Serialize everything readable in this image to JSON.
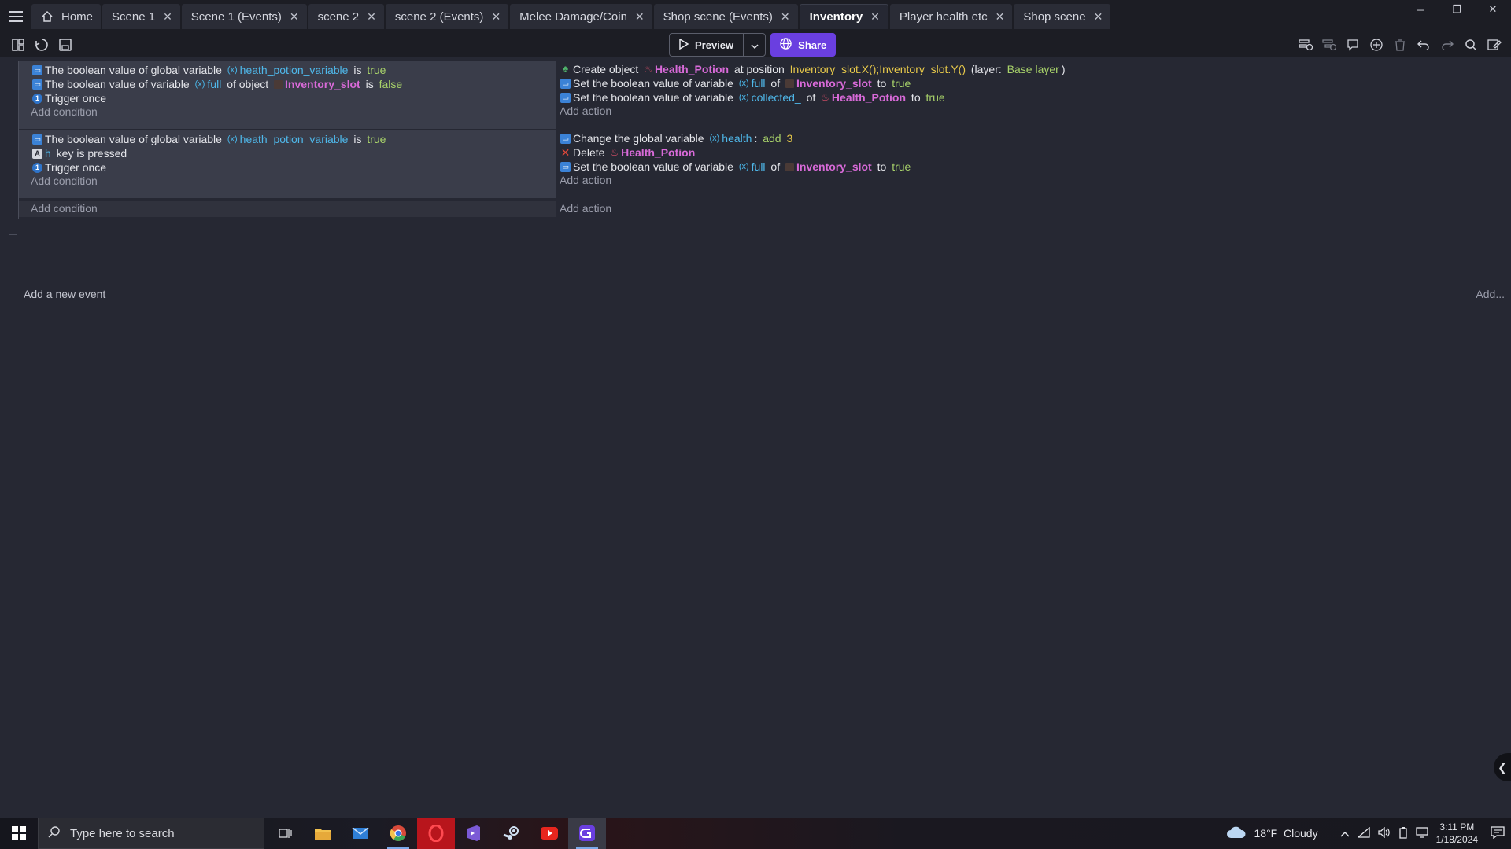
{
  "window": {
    "tabs": [
      {
        "label": "Home",
        "closable": false
      },
      {
        "label": "Scene 1",
        "closable": true
      },
      {
        "label": "Scene 1 (Events)",
        "closable": true
      },
      {
        "label": "scene 2",
        "closable": true
      },
      {
        "label": "scene 2 (Events)",
        "closable": true
      },
      {
        "label": "Melee Damage/Coin",
        "closable": true
      },
      {
        "label": "Shop scene (Events)",
        "closable": true
      },
      {
        "label": "Inventory",
        "closable": true,
        "active": true
      },
      {
        "label": "Player health etc",
        "closable": true
      },
      {
        "label": "Shop scene",
        "closable": true
      }
    ],
    "close_glyph": "✕"
  },
  "toolbar": {
    "preview_label": "Preview",
    "share_label": "Share"
  },
  "events": [
    {
      "conditions": [
        {
          "icon": "boolean-icon",
          "parts": [
            {
              "t": "The boolean value of global variable ",
              "c": "plain"
            },
            {
              "t": "(x)",
              "c": "var-icon"
            },
            {
              "t": "heath_potion_variable",
              "c": "var"
            },
            {
              "t": " is ",
              "c": "plain"
            },
            {
              "t": "true",
              "c": "bool"
            }
          ]
        },
        {
          "icon": "boolean-icon",
          "parts": [
            {
              "t": "The boolean value of variable ",
              "c": "plain"
            },
            {
              "t": "(x)",
              "c": "var-icon"
            },
            {
              "t": "full",
              "c": "var"
            },
            {
              "t": " of object ",
              "c": "plain"
            },
            {
              "t": "",
              "c": "slot-icon"
            },
            {
              "t": "Inventory_slot",
              "c": "obj"
            },
            {
              "t": " is ",
              "c": "plain"
            },
            {
              "t": "false",
              "c": "bool"
            }
          ]
        },
        {
          "icon": "trigger-icon",
          "parts": [
            {
              "t": "Trigger once",
              "c": "plain"
            }
          ]
        }
      ],
      "add_condition": "Add condition",
      "actions": [
        {
          "icon": "create-icon",
          "parts": [
            {
              "t": "Create object ",
              "c": "plain"
            },
            {
              "t": "",
              "c": "potion-icon"
            },
            {
              "t": "Health_Potion",
              "c": "obj"
            },
            {
              "t": " at position ",
              "c": "plain"
            },
            {
              "t": "Inventory_slot.X();Inventory_slot.Y()",
              "c": "expr"
            },
            {
              "t": " (layer: ",
              "c": "plain"
            },
            {
              "t": "Base layer",
              "c": "layer"
            },
            {
              "t": ")",
              "c": "plain"
            }
          ]
        },
        {
          "icon": "boolean-icon",
          "parts": [
            {
              "t": "Set the boolean value of variable ",
              "c": "plain"
            },
            {
              "t": "(x)",
              "c": "var-icon"
            },
            {
              "t": "full",
              "c": "var"
            },
            {
              "t": " of ",
              "c": "plain"
            },
            {
              "t": "",
              "c": "slot-icon"
            },
            {
              "t": "Inventory_slot",
              "c": "obj"
            },
            {
              "t": " to ",
              "c": "plain"
            },
            {
              "t": "true",
              "c": "bool"
            }
          ]
        },
        {
          "icon": "boolean-icon",
          "parts": [
            {
              "t": "Set the boolean value of variable ",
              "c": "plain"
            },
            {
              "t": "(x)",
              "c": "var-icon"
            },
            {
              "t": "collected_",
              "c": "var"
            },
            {
              "t": " of ",
              "c": "plain"
            },
            {
              "t": "",
              "c": "potion-icon"
            },
            {
              "t": "Health_Potion",
              "c": "obj"
            },
            {
              "t": " to ",
              "c": "plain"
            },
            {
              "t": "true",
              "c": "bool"
            }
          ]
        }
      ],
      "add_action": "Add action"
    },
    {
      "conditions": [
        {
          "icon": "boolean-icon",
          "parts": [
            {
              "t": "The boolean value of global variable ",
              "c": "plain"
            },
            {
              "t": "(x)",
              "c": "var-icon"
            },
            {
              "t": "heath_potion_variable",
              "c": "var"
            },
            {
              "t": " is ",
              "c": "plain"
            },
            {
              "t": "true",
              "c": "bool"
            }
          ]
        },
        {
          "icon": "key-icon",
          "parts": [
            {
              "t": "h",
              "c": "var"
            },
            {
              "t": " key is pressed",
              "c": "plain"
            }
          ]
        },
        {
          "icon": "trigger-icon",
          "parts": [
            {
              "t": "Trigger once",
              "c": "plain"
            }
          ]
        }
      ],
      "add_condition": "Add condition",
      "actions": [
        {
          "icon": "boolean-icon",
          "parts": [
            {
              "t": "Change the global variable ",
              "c": "plain"
            },
            {
              "t": "(x)",
              "c": "var-icon"
            },
            {
              "t": "health",
              "c": "var"
            },
            {
              "t": ": ",
              "c": "plain"
            },
            {
              "t": "add",
              "c": "layer"
            },
            {
              "t": " 3",
              "c": "num"
            }
          ]
        },
        {
          "icon": "delete-icon",
          "parts": [
            {
              "t": "Delete ",
              "c": "plain"
            },
            {
              "t": "",
              "c": "potion-icon"
            },
            {
              "t": "Health_Potion",
              "c": "obj"
            }
          ]
        },
        {
          "icon": "boolean-icon",
          "parts": [
            {
              "t": "Set the boolean value of variable ",
              "c": "plain"
            },
            {
              "t": "(x)",
              "c": "var-icon"
            },
            {
              "t": "full",
              "c": "var"
            },
            {
              "t": " of ",
              "c": "plain"
            },
            {
              "t": "",
              "c": "slot-icon"
            },
            {
              "t": "Inventory_slot",
              "c": "obj"
            },
            {
              "t": " to ",
              "c": "plain"
            },
            {
              "t": "true",
              "c": "bool"
            }
          ]
        }
      ],
      "add_action": "Add action"
    }
  ],
  "parent_add_condition": "Add condition",
  "parent_add_action": "Add action",
  "add_new_event": "Add a new event",
  "add_more": "Add...",
  "taskbar": {
    "search_placeholder": "Type here to search",
    "weather": "18°F  Cloudy",
    "time": "3:11 PM",
    "date": "1/18/2024"
  },
  "colors": {
    "accent": "#6a3fe0",
    "variable": "#4fb8ea",
    "object": "#d86ad8",
    "boolean": "#a8d26a",
    "number": "#e6c84a"
  }
}
